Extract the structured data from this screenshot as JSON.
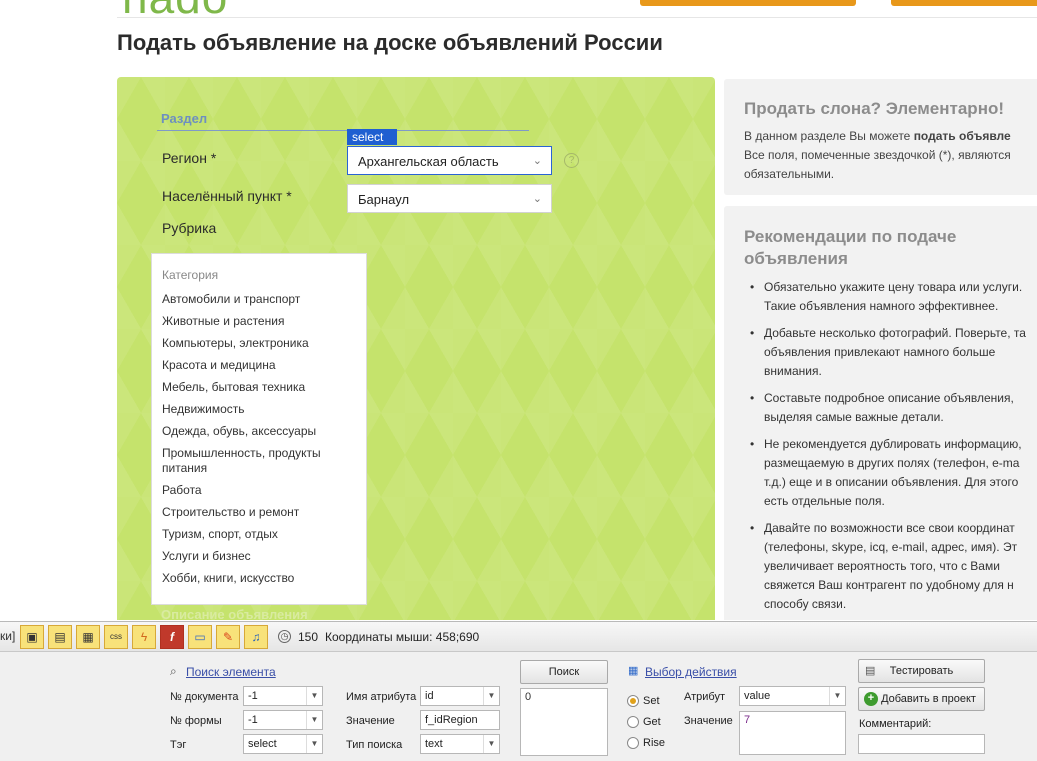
{
  "header": {
    "logo_fragment": "nado",
    "page_title": "Подать объявление на доске объявлений России"
  },
  "form": {
    "section_title": "Раздел",
    "select_tag": "select",
    "region": {
      "label": "Регион *",
      "value": "Архангельская область"
    },
    "city": {
      "label": "Населённый пункт *",
      "value": "Барнаул"
    },
    "rubric_label": "Рубрика",
    "category": {
      "heading": "Категория",
      "items": [
        "Автомобили и транспорт",
        "Животные и растения",
        "Компьютеры, электроника",
        "Красота и медицина",
        "Мебель, бытовая техника",
        "Недвижимость",
        "Одежда, обувь, аксессуары",
        "Промышленность, продукты питания",
        "Работа",
        "Строительство и ремонт",
        "Туризм, спорт, отдых",
        "Услуги и бизнес",
        "Хобби, книги, искусство"
      ]
    },
    "description_label": "Описание объявления"
  },
  "sidebar": {
    "card1": {
      "title": "Продать слона? Элементарно!",
      "text_before": "В данном разделе Вы можете ",
      "text_bold": "подать объявле",
      "text_after": "Все поля, помеченные звездочкой (*), являются обязательными."
    },
    "card2": {
      "title": "Рекомендации по подаче объявления",
      "items": [
        "Обязательно укажите цену товара или услуги. Такие объявления намного эффективнее.",
        "Добавьте несколько фотографий. Поверьте, та объявления привлекают намного больше внимания.",
        "Составьте подробное описание объявления, выделяя самые важные детали.",
        "Не рекомендуется дублировать информацию, размещаемую в других полях (телефон, e-ma т.д.) еще и в описании объявления. Для этого есть отдельные поля.",
        "Давайте по возможности все свои координат (телефоны, skype, icq, e-mail, адрес, имя). Эт увеличивает вероятность того, что с Вами свяжется Ваш контрагент по удобному для н способу связи."
      ]
    }
  },
  "tool": {
    "edge_text": "ки]",
    "counter": "150",
    "coords": "Координаты мыши: 458;690",
    "find_element": "Поиск элемента",
    "doc_no_label": "№ документа",
    "doc_no_value": "-1",
    "form_no_label": "№ формы",
    "form_no_value": "-1",
    "tag_label": "Тэг",
    "tag_value": "select",
    "attr_name_label": "Имя атрибута",
    "attr_name_value": "id",
    "value_label": "Значение",
    "value_value": "f_idRegion",
    "search_type_label": "Тип поиска",
    "search_type_value": "text",
    "search_button": "Поиск",
    "results_value": "0",
    "action_select": "Выбор действия",
    "radio_set": "Set",
    "radio_get": "Get",
    "radio_rise": "Rise",
    "attribute_label": "Атрибут",
    "attribute_value": "value",
    "action_value_label": "Значение",
    "action_value": "7",
    "test_button": "Тестировать",
    "add_button": "Добавить в проект",
    "comment_label": "Комментарий:",
    "accent": "#e0a11b"
  }
}
